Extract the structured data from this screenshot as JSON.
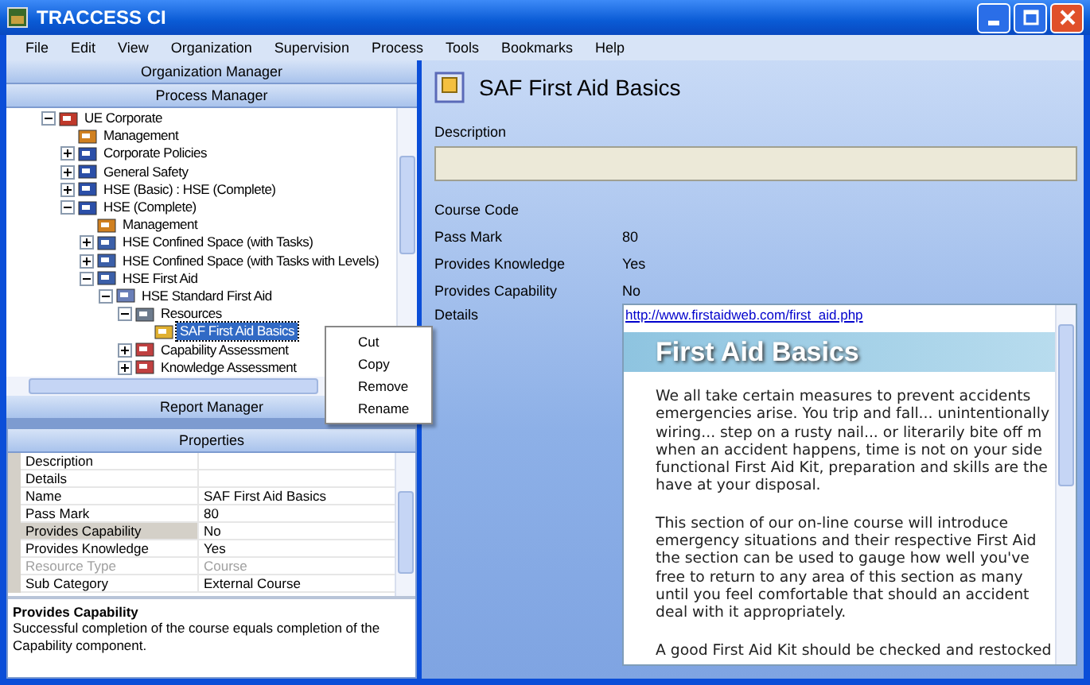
{
  "window": {
    "title": "TRACCESS CI"
  },
  "menu": [
    "File",
    "Edit",
    "View",
    "Organization",
    "Supervision",
    "Process",
    "Tools",
    "Bookmarks",
    "Help"
  ],
  "left": {
    "organization_manager": "Organization Manager",
    "process_manager": "Process Manager",
    "report_manager": "Report Manager",
    "properties_title": "Properties"
  },
  "tree": [
    {
      "label": "UE Corporate",
      "kind": "org",
      "expanded": true,
      "selected": false,
      "children": [
        {
          "label": "Management",
          "kind": "people",
          "selected": false
        },
        {
          "label": "Corporate Policies",
          "kind": "book",
          "expanded": false,
          "selected": false
        },
        {
          "label": "General Safety",
          "kind": "book",
          "expanded": false,
          "selected": false
        },
        {
          "label": "HSE (Basic) : HSE (Complete)",
          "kind": "book",
          "expanded": false,
          "selected": false
        },
        {
          "label": "HSE (Complete)",
          "kind": "book",
          "expanded": true,
          "selected": false,
          "children": [
            {
              "label": "Management",
              "kind": "people",
              "selected": false
            },
            {
              "label": "HSE  Confined Space (with Tasks)",
              "kind": "process",
              "expanded": false,
              "selected": false
            },
            {
              "label": "HSE  Confined Space (with Tasks with Levels)",
              "kind": "process",
              "expanded": false,
              "selected": false
            },
            {
              "label": "HSE  First Aid",
              "kind": "process",
              "expanded": true,
              "selected": false,
              "children": [
                {
                  "label": "HSE  Standard First Aid",
                  "kind": "task",
                  "expanded": true,
                  "selected": false,
                  "children": [
                    {
                      "label": "Resources",
                      "kind": "resources",
                      "expanded": true,
                      "selected": false,
                      "children": [
                        {
                          "label": "SAF  First Aid Basics",
                          "kind": "course",
                          "selected": true
                        }
                      ]
                    },
                    {
                      "label": "Capability Assessment",
                      "kind": "assessment",
                      "expanded": false,
                      "selected": false
                    },
                    {
                      "label": "Knowledge Assessment",
                      "kind": "assessment",
                      "expanded": false,
                      "selected": false
                    }
                  ]
                }
              ]
            }
          ]
        }
      ]
    }
  ],
  "context_menu": [
    "Cut",
    "Copy",
    "Remove",
    "Rename"
  ],
  "properties": [
    {
      "name": "Description",
      "selected": false,
      "disabled": false
    },
    {
      "name": "Details",
      "selected": false,
      "disabled": false
    },
    {
      "name": "Name",
      "value": "SAF  First Aid Basics",
      "selected": false,
      "disabled": false
    },
    {
      "name": "Pass Mark",
      "value": "80",
      "selected": false,
      "disabled": false
    },
    {
      "name": "Provides Capability",
      "value": "No",
      "selected": true,
      "disabled": false
    },
    {
      "name": "Provides Knowledge",
      "value": "Yes",
      "selected": false,
      "disabled": false
    },
    {
      "name": "Resource Type",
      "value": "Course",
      "selected": false,
      "disabled": true
    },
    {
      "name": "Sub Category",
      "value": "External Course",
      "selected": false,
      "disabled": false
    }
  ],
  "help": {
    "title": "Provides Capability",
    "text": "Successful completion of the course equals completion of the Capability component."
  },
  "detail": {
    "title": "SAF  First Aid Basics",
    "description_label": "Description",
    "fields": [
      {
        "label": "Course Code"
      },
      {
        "label": "Pass Mark",
        "value": "80"
      },
      {
        "label": "Provides Knowledge",
        "value": "Yes"
      },
      {
        "label": "Provides Capability",
        "value": "No"
      }
    ],
    "details_label": "Details"
  },
  "web": {
    "link": "http://www.firstaidweb.com/first_aid.php",
    "banner": "First Aid Basics",
    "paragraphs": [
      [
        "We all take certain measures to prevent accidents",
        "emergencies arise. You trip and fall... unintentionally",
        "wiring... step on a rusty nail... or literarily bite off m",
        "when an accident happens, time is not on your side",
        "functional First Aid Kit, preparation and skills are the",
        "have at your disposal."
      ],
      [
        "This section of our on-line course will introduce",
        "emergency situations and their respective First Aid",
        "the section can be used to gauge how well you've",
        "free to return to any area of this section as many",
        "until you feel comfortable that should an accident",
        "deal with it appropriately."
      ],
      [
        "A good First Aid Kit should be checked and restocked"
      ]
    ]
  }
}
